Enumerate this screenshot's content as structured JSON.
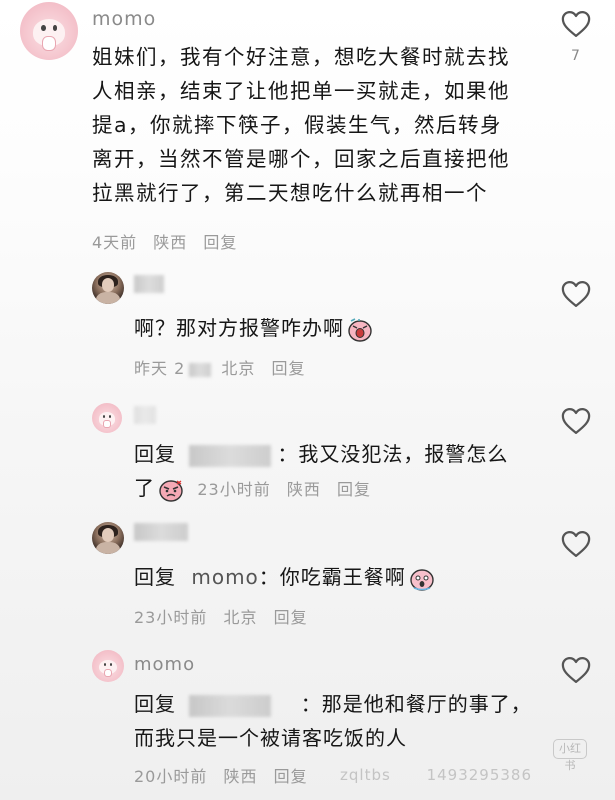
{
  "comment": {
    "username": "momo",
    "lines": [
      "姐妹们，我有个好注意，想吃大餐时就去找",
      "人相亲，结束了让他把单一买就走，如果他",
      "提a，你就摔下筷子，假装生气，然后转身",
      "离开，当然不管是哪个，回家之后直接把他",
      "拉黑就行了，第二天想吃什么就再相一个"
    ],
    "time": "4天前",
    "location": "陕西",
    "reply_label": "回复",
    "like_count": "7"
  },
  "replies": [
    {
      "username": "",
      "prefix": "",
      "text": "啊？那对方报警咋办啊",
      "emoji": "crying-emoji",
      "time": "昨天 2",
      "location": "北京",
      "reply_label": "回复"
    },
    {
      "username": "",
      "prefix": "回复",
      "text": "：我又没犯法，报警怎么",
      "text2": "了",
      "emoji": "angry-emoji",
      "time": "23小时前",
      "location": "陕西",
      "reply_label": "回复"
    },
    {
      "username": "",
      "prefix": "回复",
      "mention": "momo",
      "text": "：你吃霸王餐啊",
      "emoji": "shocked-emoji",
      "time": "23小时前",
      "location": "北京",
      "reply_label": "回复"
    },
    {
      "username": "momo",
      "prefix": "回复",
      "text": "：那是他和餐厅的事了，",
      "text2": "而我只是一个被请客吃饭的人",
      "time": "20小时前",
      "location": "陕西",
      "reply_label": "回复"
    }
  ],
  "watermark": {
    "logo": "小红书",
    "text": "zqltbs",
    "id": "1493295386"
  },
  "colors": {
    "text": "#161616",
    "meta": "#9a9a9a",
    "username": "#8a8a8a",
    "avatar_pink": "#f4c2cb"
  }
}
